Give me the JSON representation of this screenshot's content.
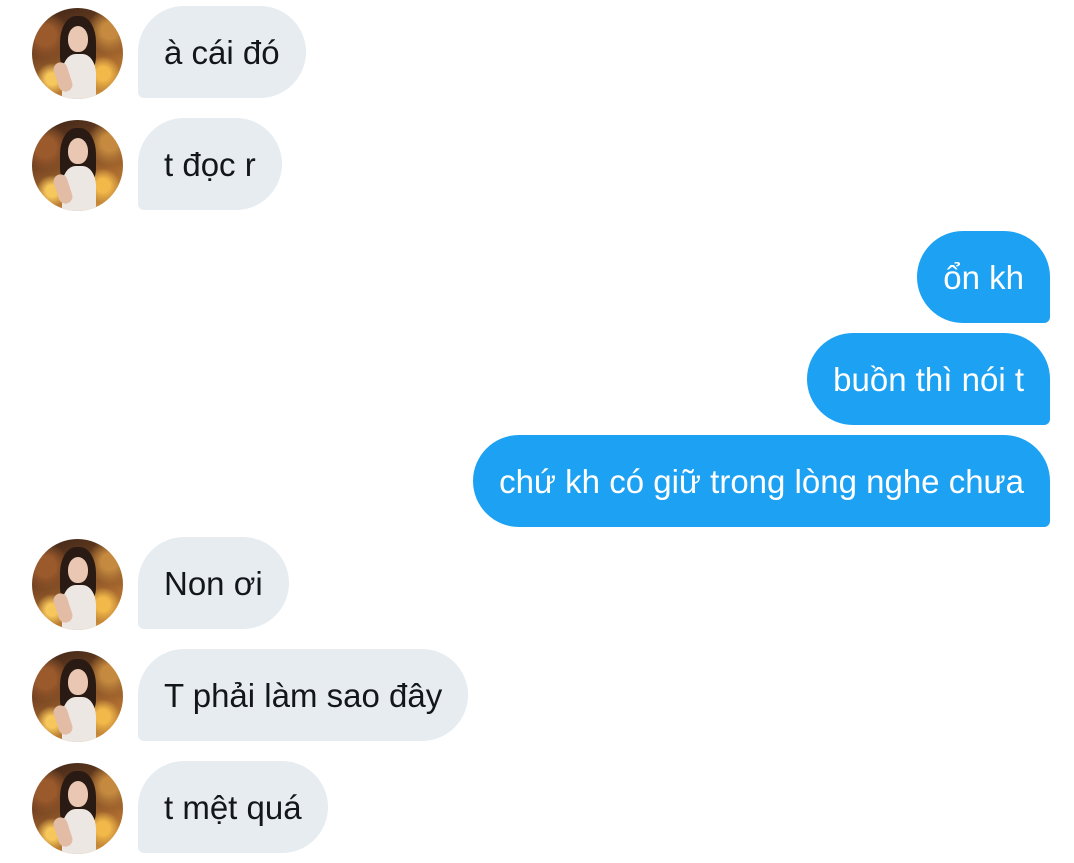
{
  "conversation": {
    "accent_incoming": "#e6ecf0",
    "accent_outgoing": "#1da1f2",
    "messages": [
      {
        "from": "them",
        "text": "à cái đó"
      },
      {
        "from": "them",
        "text": "t đọc r"
      },
      {
        "from": "me",
        "text": "ổn kh"
      },
      {
        "from": "me",
        "text": "buồn thì nói t"
      },
      {
        "from": "me",
        "text": "chứ kh có giữ trong lòng nghe chưa"
      },
      {
        "from": "them",
        "text": "Non ơi"
      },
      {
        "from": "them",
        "text": "T phải làm sao đây"
      },
      {
        "from": "them",
        "text": "t mệt quá"
      }
    ]
  }
}
